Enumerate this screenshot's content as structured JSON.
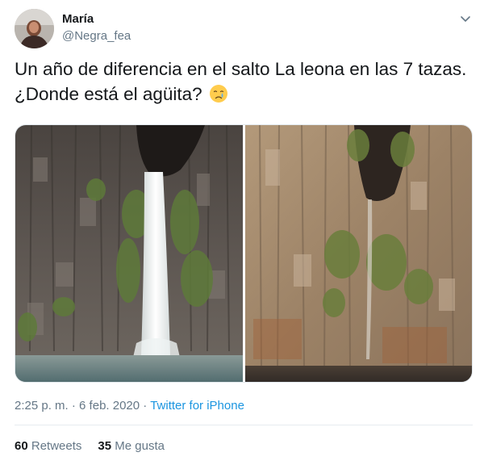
{
  "user": {
    "name": "María",
    "handle": "@Negra_fea"
  },
  "tweet": {
    "line1": "Un año de diferencia en el salto La leona en las 7 tazas.",
    "line2": "¿Donde está el agüita?",
    "emoji": "crying-face-emoji"
  },
  "media": {
    "left_photo": "waterfall-with-water",
    "right_photo": "waterfall-dry"
  },
  "meta": {
    "time": "2:25 p. m.",
    "separator": " · ",
    "date": "6 feb. 2020",
    "source": "Twitter for iPhone"
  },
  "stats": {
    "retweets_count": "60",
    "retweets_label": "Retweets",
    "likes_count": "35",
    "likes_label": "Me gusta"
  },
  "colors": {
    "text": "#14171a",
    "secondary": "#657786",
    "link": "#1b95e0",
    "divider": "#e6ecf0"
  }
}
